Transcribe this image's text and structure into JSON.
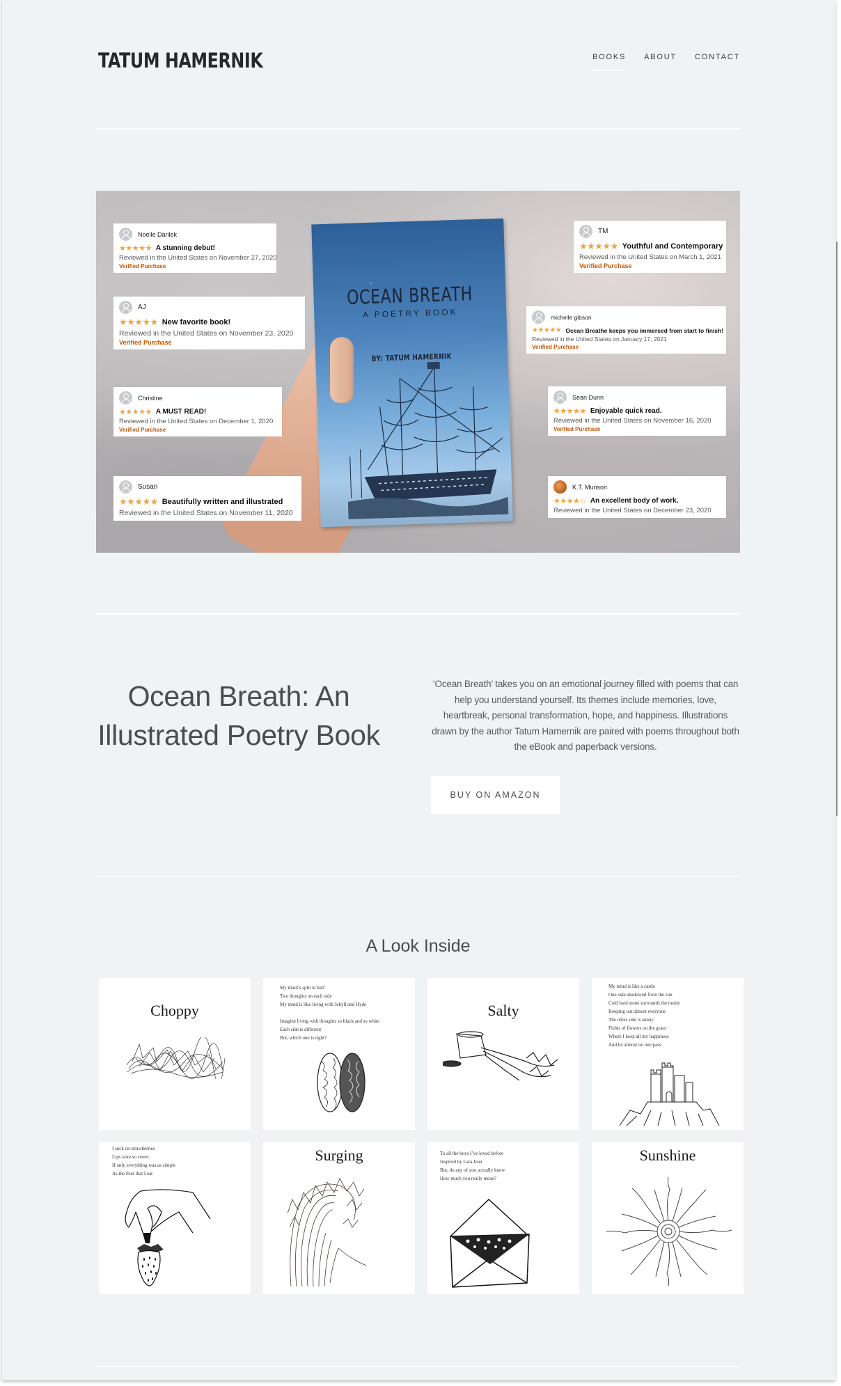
{
  "site": {
    "logo": "TATUM HAMERNIK",
    "nav": [
      {
        "label": "BOOKS",
        "active": true
      },
      {
        "label": "ABOUT",
        "active": false
      },
      {
        "label": "CONTACT",
        "active": false
      }
    ]
  },
  "hero": {
    "book": {
      "title": "OCEAN BREATH",
      "subtitle": "A POETRY BOOK",
      "author": "BY: TATUM HAMERNIK"
    },
    "reviews": [
      {
        "name": "Noelle Darilek",
        "stars": 5,
        "stars_text": "★★★★★",
        "title": "A stunning debut!",
        "date": "Reviewed in the United States on November 27, 2020",
        "verified": "Verified Purchase"
      },
      {
        "name": "AJ",
        "stars": 5,
        "stars_text": "★★★★★",
        "title": "New favorite book!",
        "date": "Reviewed in the United States on November 23, 2020",
        "verified": "Verified Purchase"
      },
      {
        "name": "Christine",
        "stars": 5,
        "stars_text": "★★★★★",
        "title": "A MUST READ!",
        "date": "Reviewed in the United States on December 1, 2020",
        "verified": "Verified Purchase"
      },
      {
        "name": "Susan",
        "stars": 5,
        "stars_text": "★★★★★",
        "title": "Beautifully written and illustrated",
        "date": "Reviewed in the United States on November 11, 2020",
        "verified": ""
      },
      {
        "name": "TM",
        "stars": 5,
        "stars_text": "★★★★★",
        "title": "Youthful and Contemporary",
        "date": "Reviewed in the United States on March 1, 2021",
        "verified": "Verified Purchase"
      },
      {
        "name": "michelle gibson",
        "stars": 5,
        "stars_text": "★★★★★",
        "title": "Ocean Breathe keeps you immersed from start to finish!",
        "date": "Reviewed in the United States on January 17, 2021",
        "verified": "Verified Purchase"
      },
      {
        "name": "Sean Dunn",
        "stars": 5,
        "stars_text": "★★★★★",
        "title": "Enjoyable quick read.",
        "date": "Reviewed in the United States on November 16, 2020",
        "verified": "Verified Purchase"
      },
      {
        "name": "K.T. Munson",
        "stars": 4,
        "stars_text": "★★★★☆",
        "title": "An excellent body of work.",
        "date": "Reviewed in the United States on December 23, 2020",
        "verified": ""
      }
    ]
  },
  "about": {
    "title": "Ocean Breath: An Illustrated Poetry Book",
    "description": "‘Ocean Breath’ takes you on an emotional journey filled with poems that can help you understand yourself. Its themes include memories, love, heartbreak, personal transformation, hope, and happiness. Illustrations drawn by the author Tatum Hamernik are paired with poems throughout both the eBook and paperback versions.",
    "button": "BUY ON AMAZON"
  },
  "look_inside": {
    "title": "A Look Inside",
    "pages": [
      {
        "type": "title",
        "title": "Choppy",
        "illustration": "scribble-waves"
      },
      {
        "type": "poem",
        "poem": "My mind’s split in half\nTwo thoughts on each side\nMy mind is like living with Jekyll and Hyde\n\nImagine living with thoughts so black and so white\nEach side is different\nBut, which one is right?",
        "illustration": "brain"
      },
      {
        "type": "title",
        "title": "Salty",
        "illustration": "spilled-salt-shaker"
      },
      {
        "type": "poem",
        "poem": "My mind is like a castle\nOne side shadowed from the sun\nCold hard stone surrounds the inside\nKeeping out almost everyone\nThe other side is sunny\nFields of flowers on the grass\nWhere I keep all my happiness\nAnd let almost no one pass",
        "illustration": "castle"
      },
      {
        "type": "poem",
        "poem": "I suck on strawberries\nLips taste so sweet\nIf only everything was as simple\nAs the fruit that I eat",
        "illustration": "hand-strawberry"
      },
      {
        "type": "title",
        "title": "Surging",
        "illustration": "wave"
      },
      {
        "type": "poem",
        "poem": "To all the boys I’ve loved before\nInspired by Lara Jean\nBut, do any of you actually know\nHow much you really mean?",
        "illustration": "envelope-flowers"
      },
      {
        "type": "title",
        "title": "Sunshine",
        "illustration": "sun"
      }
    ]
  },
  "colors": {
    "background": "#eff3f4",
    "text": "#4a4d50",
    "star": "#f2a33a",
    "verified": "#c45500"
  }
}
